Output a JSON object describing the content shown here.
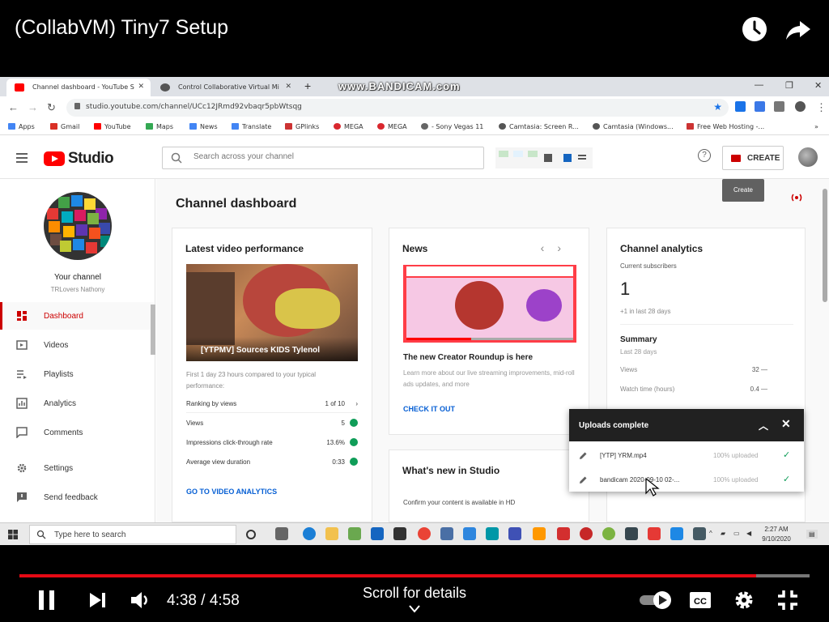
{
  "player": {
    "title": "(CollabVM) Tiny7 Setup",
    "time_current": "4:38",
    "time_separator": "/",
    "time_total": "4:58",
    "progress_fraction": 0.932,
    "scroll_label": "Scroll for details",
    "accent_color": "#e50914"
  },
  "browser": {
    "tabs": [
      {
        "label": "Channel dashboard - YouTube S",
        "favicon_color": "#ff0000"
      },
      {
        "label": "Control Collaborative Virtual Mi",
        "favicon_color": "#555555"
      }
    ],
    "watermark": "www.BANDICAM.com",
    "url": "studio.youtube.com/channel/UCc12JRmd92vbaqr5pbWtsqg",
    "bookmarks": [
      {
        "label": "Apps",
        "color": "#4285f4"
      },
      {
        "label": "Gmail",
        "color": "#d93025"
      },
      {
        "label": "YouTube",
        "color": "#ff0000"
      },
      {
        "label": "Maps",
        "color": "#34a853"
      },
      {
        "label": "News",
        "color": "#4285f4"
      },
      {
        "label": "Translate",
        "color": "#4285f4"
      },
      {
        "label": "GPlinks",
        "color": "#cc3333"
      },
      {
        "label": "MEGA",
        "color": "#d9272e"
      },
      {
        "label": "MEGA",
        "color": "#d9272e"
      },
      {
        "label": "- Sony Vegas 11",
        "color": "#666666"
      },
      {
        "label": "Camtasia: Screen R...",
        "color": "#555555"
      },
      {
        "label": "Camtasia (Windows...",
        "color": "#555555"
      },
      {
        "label": "Free Web Hosting -...",
        "color": "#cc3333"
      }
    ]
  },
  "studio": {
    "logo_text": "Studio",
    "search_placeholder": "Search across your channel",
    "create_label": "CREATE",
    "create_tooltip": "Create",
    "sidebar": {
      "your_channel": "Your channel",
      "channel_name": "TRLovers Nathony",
      "items": [
        {
          "label": "Dashboard",
          "icon": "dashboard-icon"
        },
        {
          "label": "Videos",
          "icon": "videos-icon"
        },
        {
          "label": "Playlists",
          "icon": "playlists-icon"
        },
        {
          "label": "Analytics",
          "icon": "analytics-icon"
        },
        {
          "label": "Comments",
          "icon": "comments-icon"
        },
        {
          "label": "Settings",
          "icon": "settings-icon"
        },
        {
          "label": "Send feedback",
          "icon": "feedback-icon"
        }
      ]
    },
    "page_title": "Channel dashboard",
    "latest_video": {
      "title": "Latest video performance",
      "video_title": "[YTPMV] Sources KIDS Tylenol",
      "note": "First 1 day 23 hours compared to your typical performance:",
      "rows": [
        {
          "label": "Ranking by views",
          "value": "1 of 10"
        },
        {
          "label": "Views",
          "value": "5"
        },
        {
          "label": "Impressions click-through rate",
          "value": "13.6%"
        },
        {
          "label": "Average view duration",
          "value": "0:33"
        }
      ],
      "link": "GO TO VIDEO ANALYTICS"
    },
    "news": {
      "title": "News",
      "headline": "The new Creator Roundup is here",
      "body": "Learn more about our live streaming improvements, mid-roll ads updates, and more",
      "link": "CHECK IT OUT"
    },
    "whats_new": {
      "title": "What's new in Studio",
      "item": "Confirm your content is available in HD"
    },
    "analytics": {
      "title": "Channel analytics",
      "subs_label": "Current subscribers",
      "subs_value": "1",
      "subs_delta": "+1 in last 28 days",
      "summary_label": "Summary",
      "summary_period": "Last 28 days",
      "rows": [
        {
          "label": "Views",
          "value": "32 —"
        },
        {
          "label": "Watch time (hours)",
          "value": "0.4 —"
        }
      ]
    },
    "uploads": {
      "title": "Uploads complete",
      "items": [
        {
          "file": "[YTP] YRM.mp4",
          "status": "100% uploaded"
        },
        {
          "file": "bandicam 2020-09-10 02-...",
          "status": "100% uploaded"
        }
      ]
    }
  },
  "taskbar": {
    "search_placeholder": "Type here to search",
    "time": "2:27 AM",
    "date": "9/10/2020"
  }
}
